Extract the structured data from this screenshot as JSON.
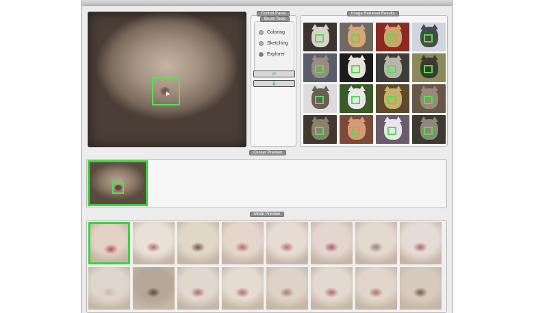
{
  "window": {
    "title": ""
  },
  "panels": {
    "control": "Control Panel",
    "brush": "Brush Tools",
    "retrieval": "Image Retrieval Results",
    "cluster": "Cluster Preview",
    "mode": "Mode Preview"
  },
  "brush_tools": [
    {
      "label": "Coloring",
      "selected": false
    },
    {
      "label": "Sketching",
      "selected": false
    },
    {
      "label": "Explorer",
      "selected": true
    }
  ],
  "buttons": {
    "refresh_glyph": "⟳",
    "down_glyph": "⇊"
  },
  "colors": {
    "selection": "#44dd44",
    "window_bg": "#ececec"
  },
  "retrieval_thumbs": [
    {
      "bg": "#3a3530",
      "fur": "#d8d2c8"
    },
    {
      "bg": "#6e6a62",
      "fur": "#d6a777"
    },
    {
      "bg": "#8a2a22",
      "fur": "#cfa36b"
    },
    {
      "bg": "#cfd6e0",
      "fur": "#4a4a4a"
    },
    {
      "bg": "#5a5e6a",
      "fur": "#9a8c80"
    },
    {
      "bg": "#1c1c1c",
      "fur": "#e9e4da"
    },
    {
      "bg": "#3d3d3a",
      "fur": "#b9b5ac"
    },
    {
      "bg": "#8b8a5a",
      "fur": "#3a3a30"
    },
    {
      "bg": "#dcdcdc",
      "fur": "#6a5f55"
    },
    {
      "bg": "#3a5a2a",
      "fur": "#e8e8e8"
    },
    {
      "bg": "#5d4a2e",
      "fur": "#c8b06a"
    },
    {
      "bg": "#6a5648",
      "fur": "#9b8a7a"
    },
    {
      "bg": "#41392e",
      "fur": "#8a7f70"
    },
    {
      "bg": "#7a4a3a",
      "fur": "#d69a74"
    },
    {
      "bg": "#6a5c6a",
      "fur": "#e8e6e8"
    },
    {
      "bg": "#3a3a30",
      "fur": "#8f8778"
    }
  ],
  "mode_cells": [
    {
      "bg": "#e3d2c6",
      "mark": "#b4545e",
      "selected": true
    },
    {
      "bg": "#e9e1d7",
      "mark": "#b07068",
      "selected": false
    },
    {
      "bg": "#e1d7c5",
      "mark": "#6e5842",
      "selected": false
    },
    {
      "bg": "#e4d6cc",
      "mark": "#b06c70",
      "selected": false
    },
    {
      "bg": "#e6dcd3",
      "mark": "#b4707a",
      "selected": false
    },
    {
      "bg": "#e3d6cf",
      "mark": "#b05a68",
      "selected": false
    },
    {
      "bg": "#e2d9cf",
      "mark": "#9a8270",
      "selected": false
    },
    {
      "bg": "#e6dcd6",
      "mark": "#a46a6a",
      "selected": false
    },
    {
      "bg": "#ddd6cc",
      "mark": "#c9b8a8",
      "selected": false
    },
    {
      "bg": "#b6a898",
      "mark": "#5a4a3e",
      "selected": false
    },
    {
      "bg": "#e1d8cf",
      "mark": "#ad6e74",
      "selected": false
    },
    {
      "bg": "#e4dbd1",
      "mark": "#b26c74",
      "selected": false
    },
    {
      "bg": "#ded3c8",
      "mark": "#b07a7a",
      "selected": false
    },
    {
      "bg": "#e4d9d0",
      "mark": "#b0646e",
      "selected": false
    },
    {
      "bg": "#e0d6cb",
      "mark": "#b87076",
      "selected": false
    },
    {
      "bg": "#d6cbbd",
      "mark": "#6e5a48",
      "selected": false
    }
  ]
}
